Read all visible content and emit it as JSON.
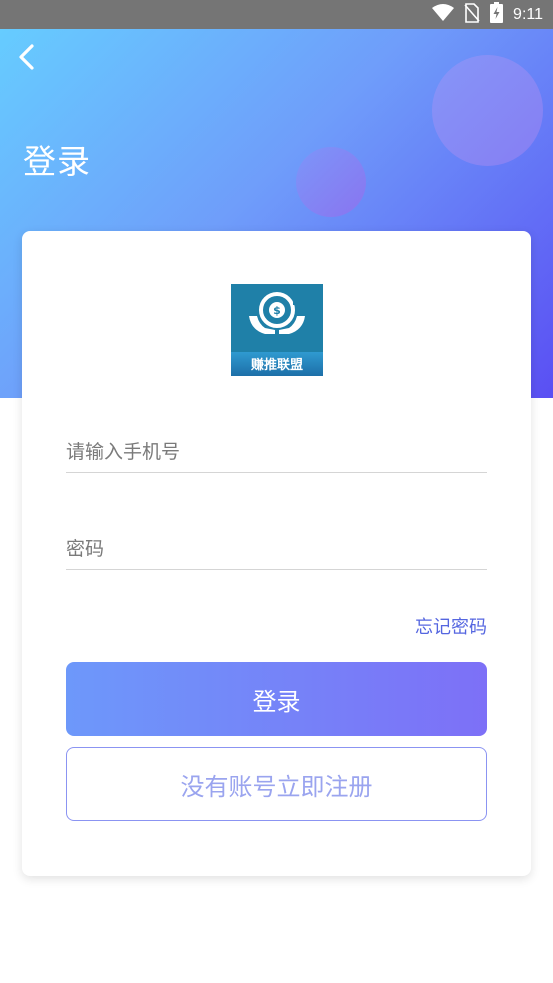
{
  "status_bar": {
    "time": "9:11",
    "icons": [
      "wifi-icon",
      "no-sim-icon",
      "battery-charging-icon"
    ]
  },
  "header": {
    "title": "登录",
    "back_icon": "chevron-left-icon"
  },
  "logo": {
    "text": "赚推联盟"
  },
  "form": {
    "phone_placeholder": "请输入手机号",
    "password_placeholder": "密码",
    "forgot_label": "忘记密码",
    "login_label": "登录",
    "register_label": "没有账号立即注册"
  },
  "colors": {
    "accent": "#6d98fa",
    "accent_end": "#7d70f7",
    "link": "#5566e0",
    "register_text": "#9aa4ef"
  }
}
